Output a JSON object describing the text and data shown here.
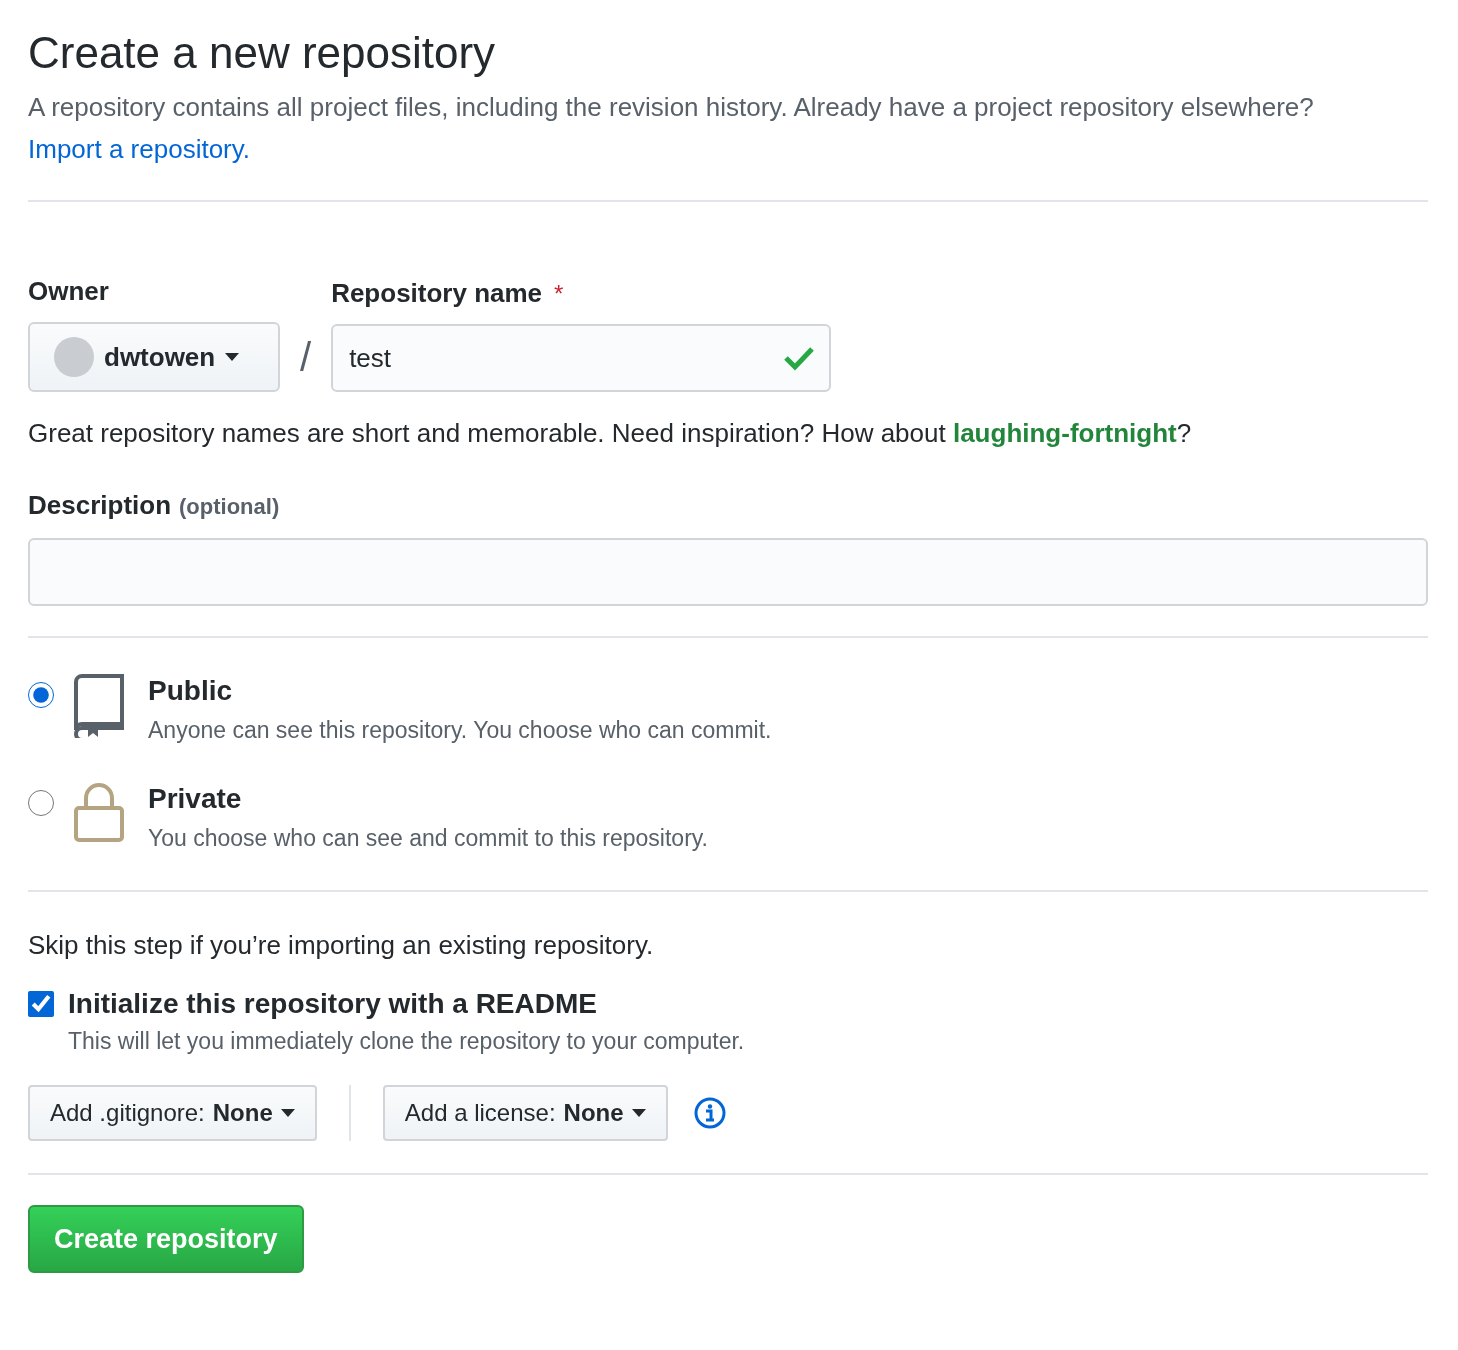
{
  "title": "Create a new repository",
  "intro": {
    "text": "A repository contains all project files, including the revision history. Already have a project repository elsewhere?",
    "link": "Import a repository."
  },
  "owner": {
    "label": "Owner",
    "value": "dwtowen"
  },
  "separator": "/",
  "repo_name": {
    "label": "Repository name",
    "required_mark": "*",
    "value": "test",
    "valid": true
  },
  "name_hint": {
    "text": "Great repository names are short and memorable. Need inspiration? How about",
    "suggestion": "laughing-fortnight",
    "end": "?"
  },
  "description": {
    "label": "Description",
    "optional": "(optional)"
  },
  "visibility": [
    {
      "kind": "public",
      "title": "Public",
      "text": "Anyone can see this repository. You choose who can commit.",
      "selected": true
    },
    {
      "kind": "private",
      "title": "Private",
      "text": "You choose who can see and commit to this repository.",
      "selected": false
    }
  ],
  "init_note": "Skip this step if you’re importing an existing repository.",
  "readme": {
    "label": "Initialize this repository with a README",
    "help": "This will let you immediately clone the repository to your computer.",
    "checked": true
  },
  "selects": [
    {
      "label": "Add .gitignore:",
      "value": "None"
    },
    {
      "label": "Add a license:",
      "value": "None"
    }
  ],
  "submit": "Create repository"
}
